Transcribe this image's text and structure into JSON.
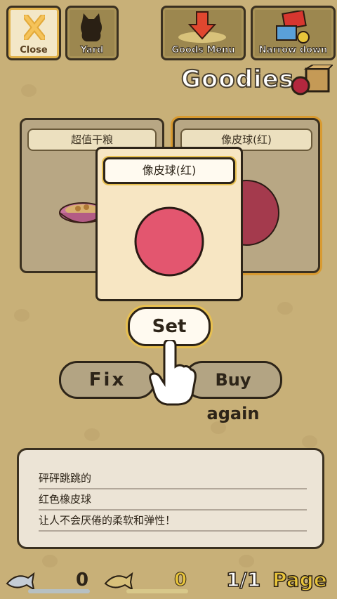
{
  "header": {
    "close_label": "Close",
    "yard_label": "Yard",
    "goods_menu_label": "Goods Menu",
    "narrow_down_label": "Narrow down",
    "title": "Goodies"
  },
  "cards": [
    {
      "name": "超值干粮"
    },
    {
      "name": "像皮球(红)"
    }
  ],
  "popup": {
    "name": "像皮球(红)"
  },
  "actions": {
    "set_label": "Set",
    "fix_label": "Fix",
    "buy_again_label": "Buy again"
  },
  "description": {
    "lines": [
      "砰砰跳跳的",
      "红色橡皮球",
      "让人不会厌倦的柔软和弹性！"
    ]
  },
  "footer": {
    "fish_silver_count": "0",
    "fish_gold_count": "0",
    "page_indicator": "1/1",
    "page_label": "Page"
  },
  "colors": {
    "background": "#c8b078",
    "ball_red": "#e3566f",
    "ball_dark_red": "#a43a4d",
    "selected_outline": "#d89a30"
  },
  "icons": {
    "close": "x-icon",
    "yard": "cat-silhouette-icon",
    "goods_menu": "down-arrow-icon",
    "narrow_down": "box-filter-icon",
    "goodies": "ball-and-box-icon",
    "pointer": "hand-pointer-icon",
    "fish_silver": "silver-fish-icon",
    "fish_gold": "gold-fish-icon"
  }
}
